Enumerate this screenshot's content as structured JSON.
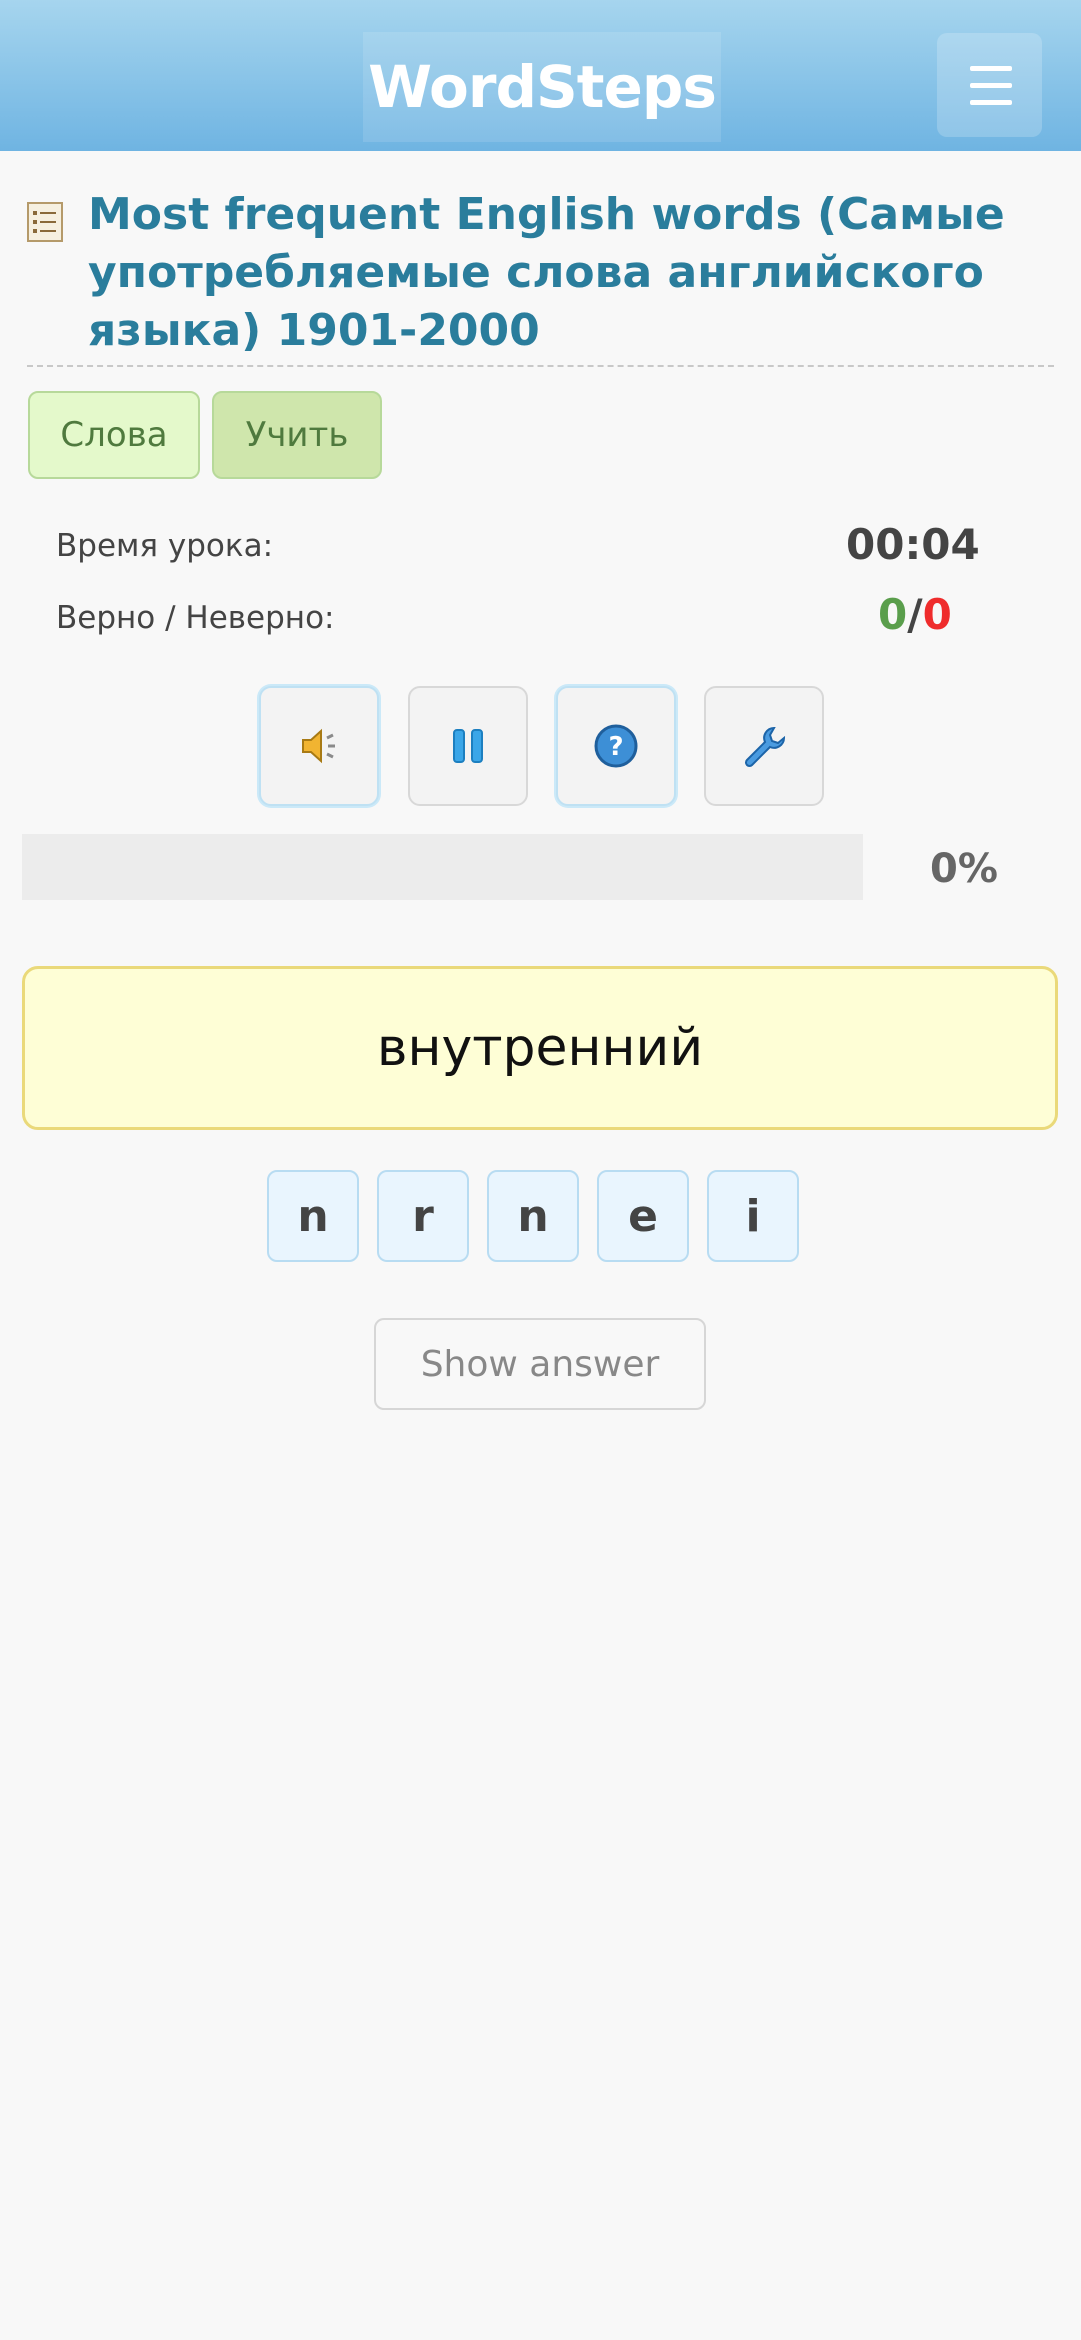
{
  "header": {
    "logo_text": "WordSteps",
    "menu_icon": "hamburger-menu-icon"
  },
  "page": {
    "title": "Most frequent English words (Самые употребляемые слова английского языка) 1901-2000",
    "title_icon": "word-list-icon"
  },
  "tabs": [
    {
      "label": "Слова",
      "active": false
    },
    {
      "label": "Учить",
      "active": true
    }
  ],
  "stats": {
    "time_label": "Время урока:",
    "time_value": "00:04",
    "score_label": "Верно / Неверно:",
    "correct": "0",
    "separator": "/",
    "wrong": "0"
  },
  "toolbar": [
    {
      "icon": "speaker-icon"
    },
    {
      "icon": "pause-icon"
    },
    {
      "icon": "help-icon"
    },
    {
      "icon": "wrench-icon"
    }
  ],
  "progress": {
    "fraction": 0,
    "label": "0%"
  },
  "exercise": {
    "prompt_word": "внутренний",
    "letters": [
      "n",
      "r",
      "n",
      "e",
      "i"
    ],
    "show_answer_label": "Show answer"
  },
  "colors": {
    "header_top": "#a6d5ee",
    "header_bottom": "#6fb4e2",
    "title": "#2a7d9c",
    "correct": "#5a9e4c",
    "wrong": "#ef2c2c"
  }
}
